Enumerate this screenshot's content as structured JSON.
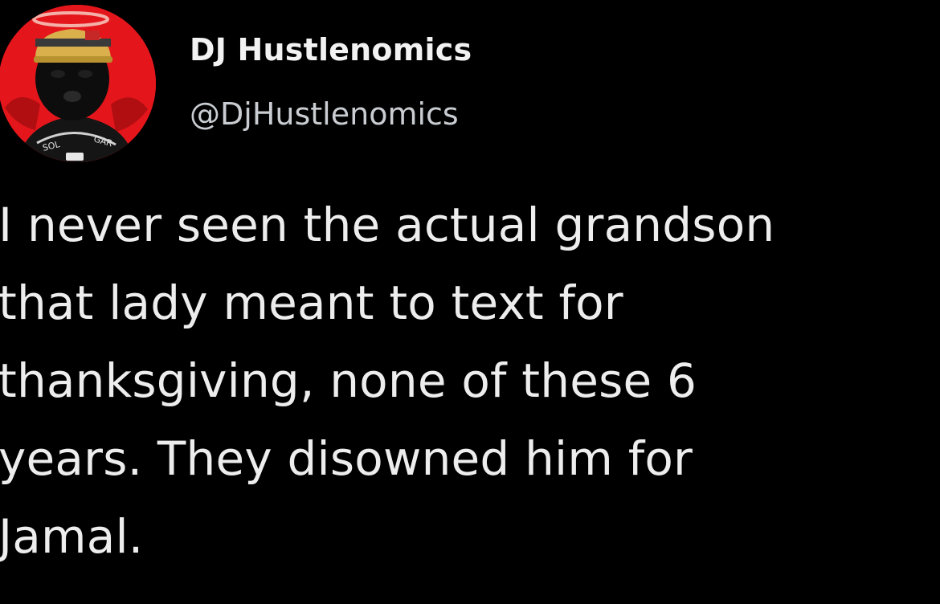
{
  "tweet": {
    "author": {
      "display_name": "DJ Hustlenomics",
      "handle": "@DjHustlenomics",
      "avatar_icon": "profile-avatar-red-devil-figure",
      "avatar_bg": "#e4161b"
    },
    "text_lines": [
      "I never seen the actual grandson",
      "that lady meant to text for",
      "thanksgiving, none of these 6",
      "years. They disowned him for",
      "Jamal."
    ]
  },
  "colors": {
    "background": "#000000",
    "text_primary": "#ededed",
    "text_secondary": "#c9cdd1"
  }
}
